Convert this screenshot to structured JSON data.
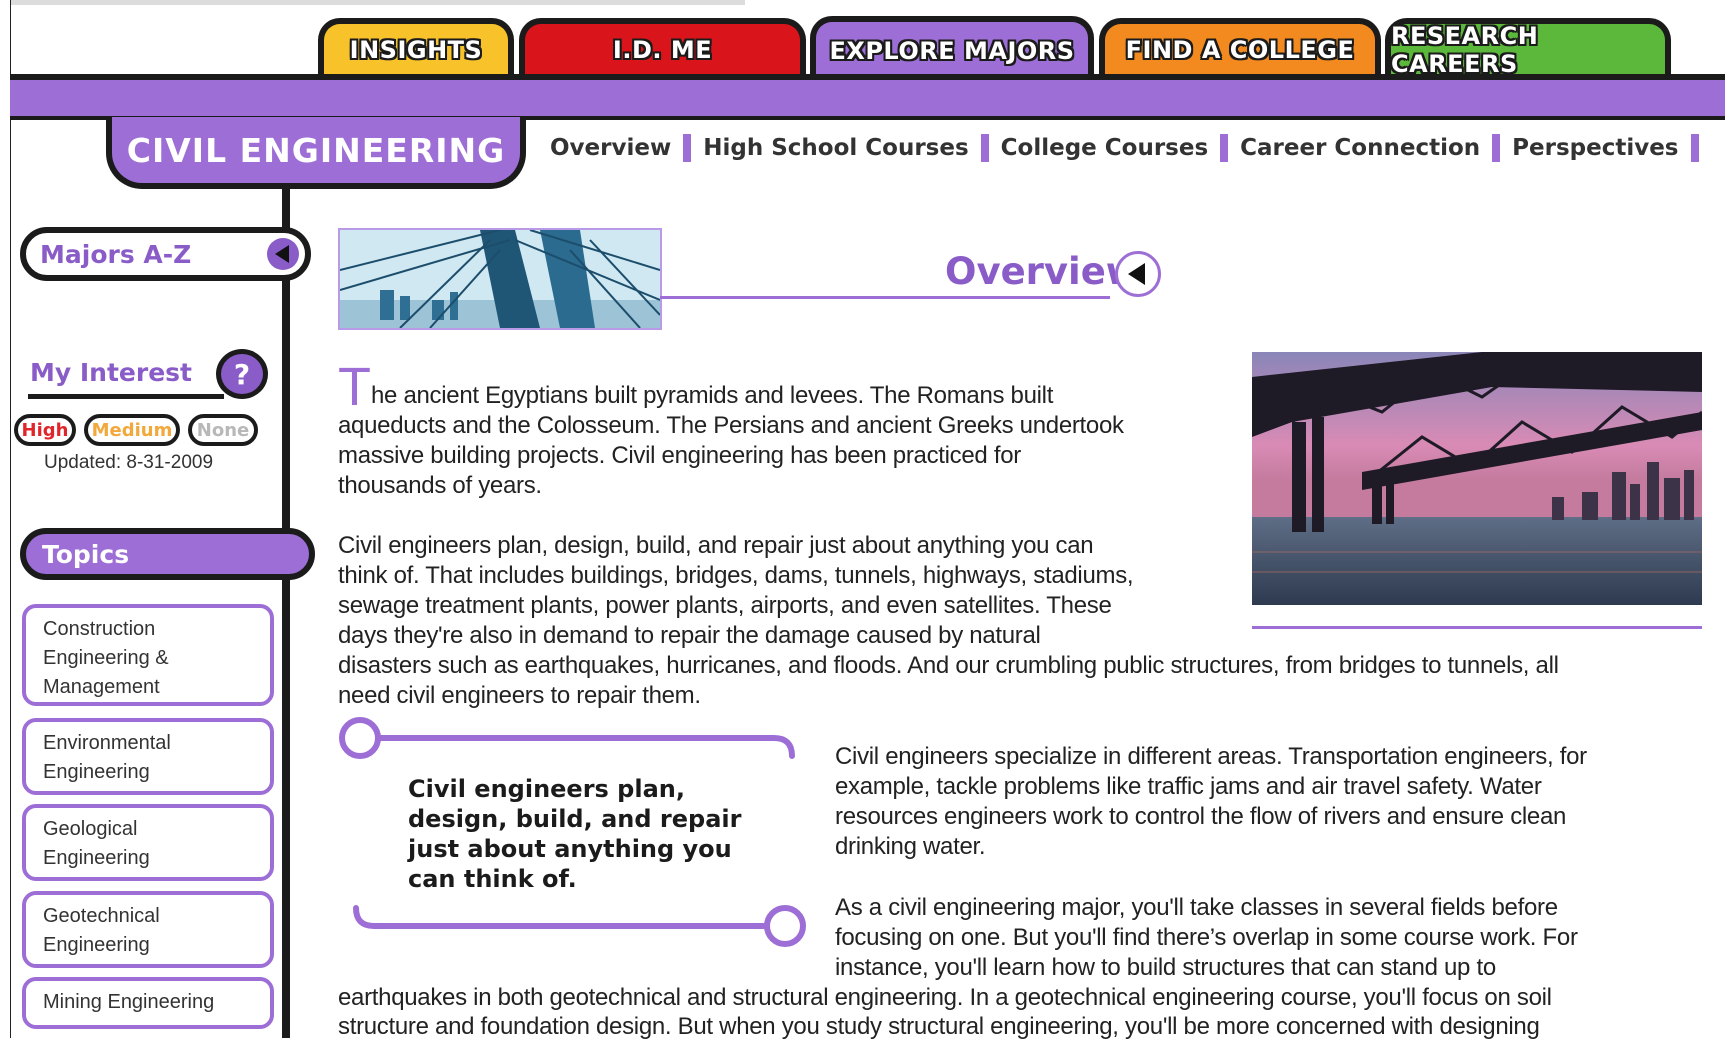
{
  "tabs": [
    {
      "label": "INSIGHTS"
    },
    {
      "label": "I.D. ME"
    },
    {
      "label": "EXPLORE MAJORS"
    },
    {
      "label": "FIND A COLLEGE"
    },
    {
      "label": "RESEARCH CAREERS"
    }
  ],
  "major": {
    "title": "CIVIL ENGINEERING"
  },
  "subnav": [
    "Overview",
    "High School Courses",
    "College Courses",
    "Career Connection",
    "Perspectives"
  ],
  "sidebar": {
    "majors_az": "Majors A-Z",
    "interest": {
      "title": "My Interest",
      "help": "?",
      "high": "High",
      "medium": "Medium",
      "none": "None",
      "updated": "Updated: 8-31-2009"
    },
    "topics_title": "Topics",
    "topics": [
      {
        "label": "Construction Engineering & Management"
      },
      {
        "label": "Environmental Engineering"
      },
      {
        "label": "Geological Engineering"
      },
      {
        "label": "Geotechnical Engineering"
      },
      {
        "label": "Mining Engineering"
      }
    ]
  },
  "main": {
    "section_title": "Overview",
    "dropcap": "T",
    "p1_lines": [
      "he ancient Egyptians built pyramids and levees. The Romans built",
      "aqueducts and the Colosseum. The Persians and ancient Greeks undertook",
      "massive building projects. Civil engineering has been practiced for",
      "thousands of years."
    ],
    "p2_lines": [
      "Civil engineers plan, design, build, and repair just about anything you can",
      "think of. That includes buildings, bridges, dams, tunnels, highways, stadiums,",
      "sewage treatment plants, power plants, airports, and even satellites. These",
      "days they're also in demand to repair the damage caused by natural",
      "disasters such as earthquakes, hurricanes, and floods. And our crumbling public structures, from bridges to tunnels, all",
      "need civil engineers to repair them."
    ],
    "quote_lines": [
      "Civil engineers plan,",
      "design, build, and repair",
      "just about anything you",
      "can think of."
    ],
    "p3_lines": [
      "Civil engineers specialize in different areas. Transportation engineers, for",
      "example, tackle problems like traffic jams and air travel safety. Water",
      "resources engineers work to control the flow of rivers and ensure clean",
      "drinking water."
    ],
    "p4_lines": [
      "As a civil engineering major, you'll take classes in several fields before",
      "focusing on one. But you'll find there’s overlap in some course work. For",
      "instance, you'll learn how to build structures that can stand up to",
      "earthquakes in both geotechnical and structural engineering. In a geotechnical engineering course, you'll focus on soil",
      "structure and foundation design. But when you study structural engineering, you'll be more concerned with designing"
    ]
  },
  "colors": {
    "accent": "#9d6fd6",
    "insights": "#f7c22a",
    "idme": "#d9141b",
    "find": "#f28a1f",
    "research": "#5bb83a"
  }
}
